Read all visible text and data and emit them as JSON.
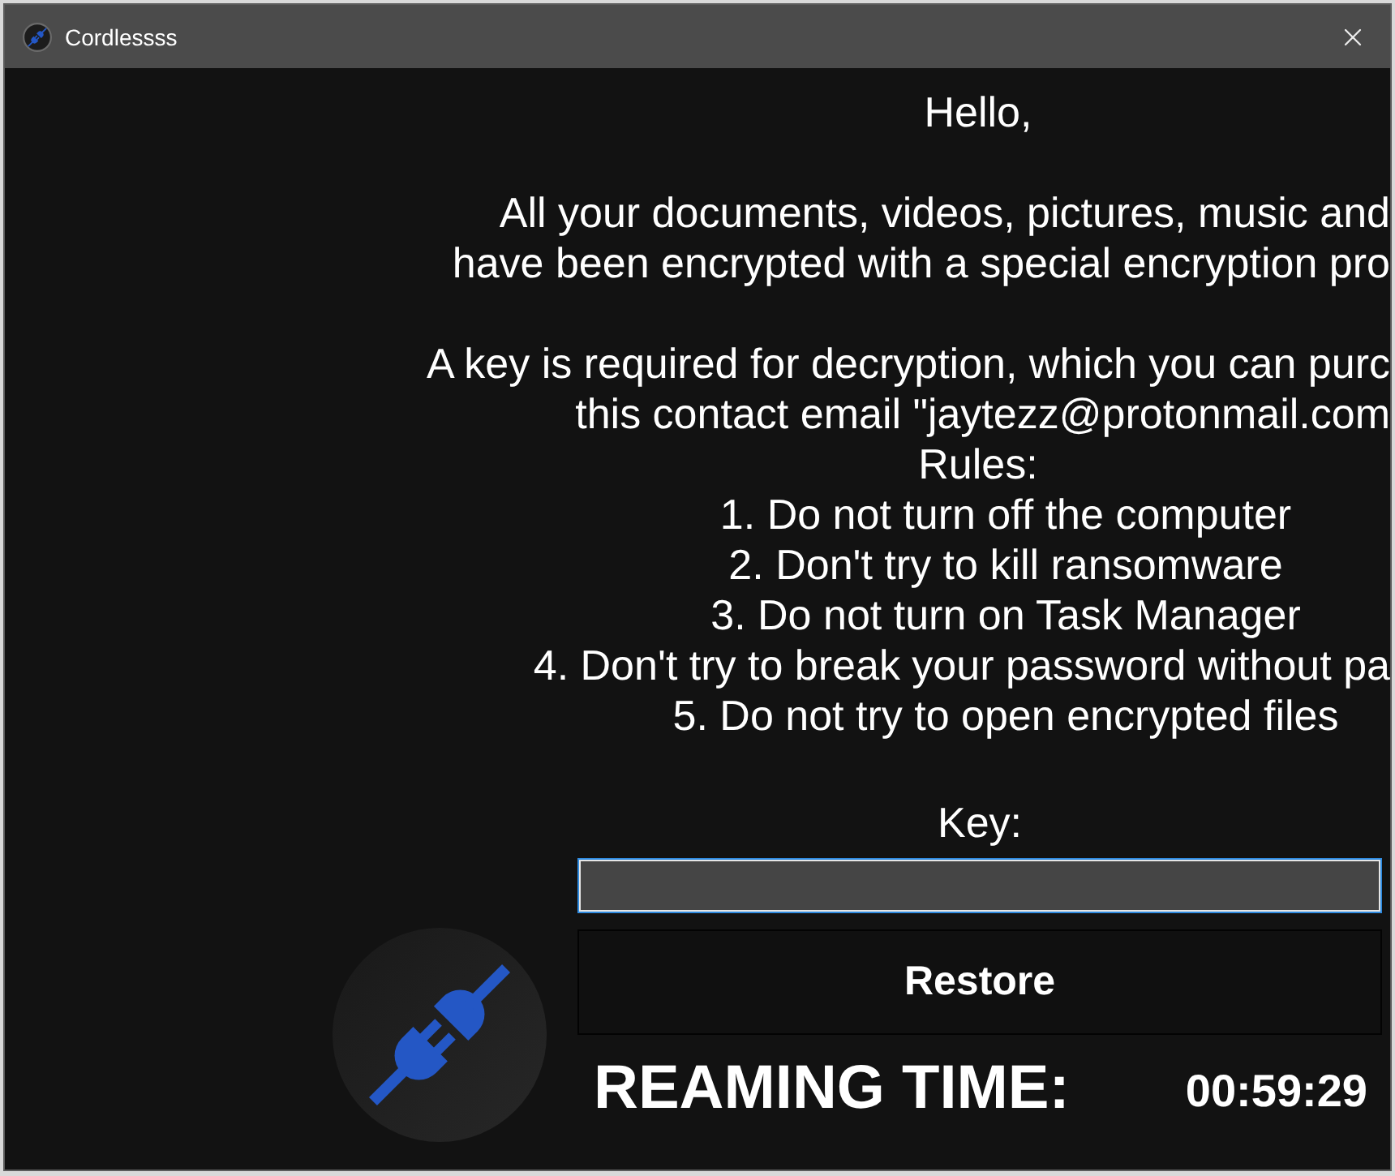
{
  "window": {
    "title": "Cordlessss"
  },
  "message": {
    "greeting": "Hello,",
    "paragraphs": [
      {
        "lines": [
          {
            "text": "All your documents, videos, pictures, music and",
            "clipped": true
          },
          {
            "text": "have been encrypted with a special encryption pro",
            "clipped": true
          }
        ]
      },
      {
        "lines": [
          {
            "text": "A key is required for decryption, which you can purc",
            "clipped": true
          },
          {
            "text": "this contact email \"jaytezz@protonmail.com",
            "clipped": true
          }
        ]
      }
    ],
    "rules_title": "Rules:",
    "rules": [
      {
        "text": "1. Do not turn off the computer",
        "clipped": false
      },
      {
        "text": "2. Don't try to kill ransomware",
        "clipped": false
      },
      {
        "text": "3. Do not turn on Task Manager",
        "clipped": false
      },
      {
        "text": "4. Don't try to break your password without pa",
        "clipped": true
      },
      {
        "text": "5. Do not try to open encrypted files",
        "clipped": false
      }
    ]
  },
  "key_field": {
    "label": "Key:",
    "focused": true
  },
  "restore_button": {
    "label": "Restore"
  },
  "timer": {
    "label": "REAMING TIME:",
    "value": "00:59:29"
  }
}
